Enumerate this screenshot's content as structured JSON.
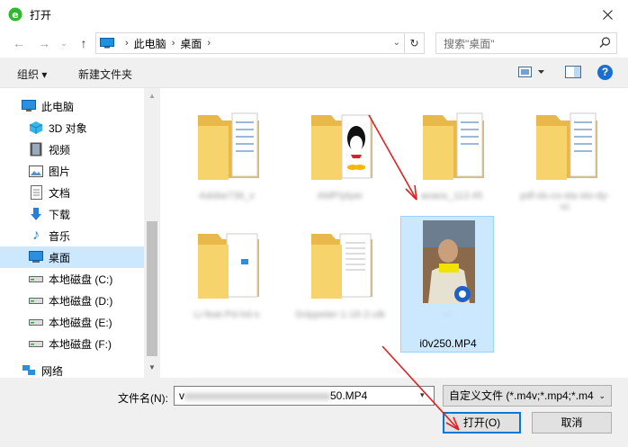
{
  "window": {
    "title": "打开"
  },
  "address": {
    "crumbs": [
      "此电脑",
      "桌面"
    ]
  },
  "search": {
    "placeholder": "搜索\"桌面\""
  },
  "toolbar": {
    "organize": "组织",
    "new_folder": "新建文件夹",
    "help": "?"
  },
  "sidebar": {
    "items": [
      {
        "label": "此电脑",
        "icon": "pc-icon"
      },
      {
        "label": "3D 对象",
        "icon": "cube-icon"
      },
      {
        "label": "视频",
        "icon": "video-icon"
      },
      {
        "label": "图片",
        "icon": "picture-icon"
      },
      {
        "label": "文档",
        "icon": "document-icon"
      },
      {
        "label": "下载",
        "icon": "download-icon"
      },
      {
        "label": "音乐",
        "icon": "music-icon"
      },
      {
        "label": "桌面",
        "icon": "desktop-icon"
      },
      {
        "label": "本地磁盘 (C:)",
        "icon": "drive-icon"
      },
      {
        "label": "本地磁盘 (D:)",
        "icon": "drive-icon"
      },
      {
        "label": "本地磁盘 (E:)",
        "icon": "drive-icon"
      },
      {
        "label": "本地磁盘 (F:)",
        "icon": "drive-icon"
      },
      {
        "label": "网络",
        "icon": "network-icon"
      }
    ]
  },
  "files": [
    {
      "label": "Adobe736_v",
      "type": "folder"
    },
    {
      "label": "AMP/plyer",
      "type": "folder-qq"
    },
    {
      "label": "aoaos_113.45",
      "type": "folder"
    },
    {
      "label": "pdf-ds-cs-sla-slo-dy-xc",
      "type": "folder"
    },
    {
      "label": "Li-feat-Pd-hd-s",
      "type": "folder"
    },
    {
      "label": "Snippeter-1-16-2-ulk",
      "type": "folder"
    },
    {
      "label_blur": "…",
      "label": "i0v250.MP4",
      "type": "video"
    }
  ],
  "footer": {
    "filename_label": "文件名(N):",
    "filename_prefix": "v",
    "filename_suffix": "50.MP4",
    "filetype": "自定义文件 (*.m4v;*.mp4;*.m4",
    "open": "打开(O)",
    "cancel": "取消"
  },
  "colors": {
    "accent": "#0078d7",
    "selection": "#cce8ff",
    "annotation": "#e02020"
  }
}
